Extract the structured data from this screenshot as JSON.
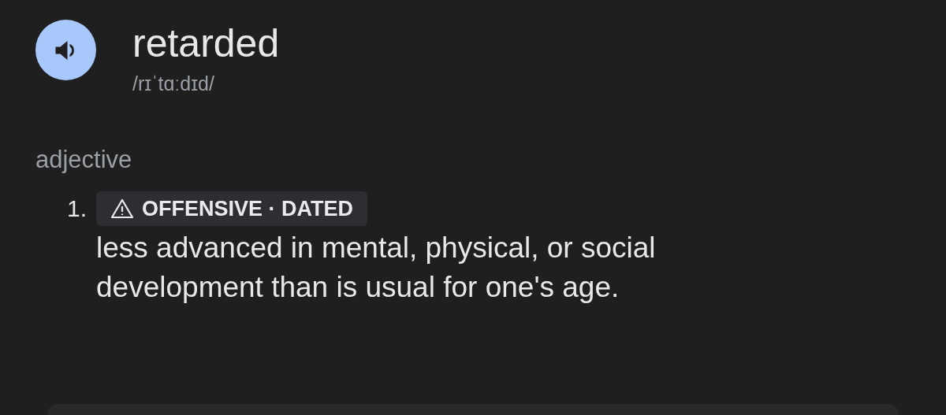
{
  "entry": {
    "word": "retarded",
    "pronunciation": "/rɪˈtɑːdɪd/"
  },
  "part_of_speech": "adjective",
  "senses": [
    {
      "number": "1.",
      "labels": "OFFENSIVE · DATED",
      "definition": "less advanced in mental, physical, or social development than is usual for one's age."
    }
  ]
}
